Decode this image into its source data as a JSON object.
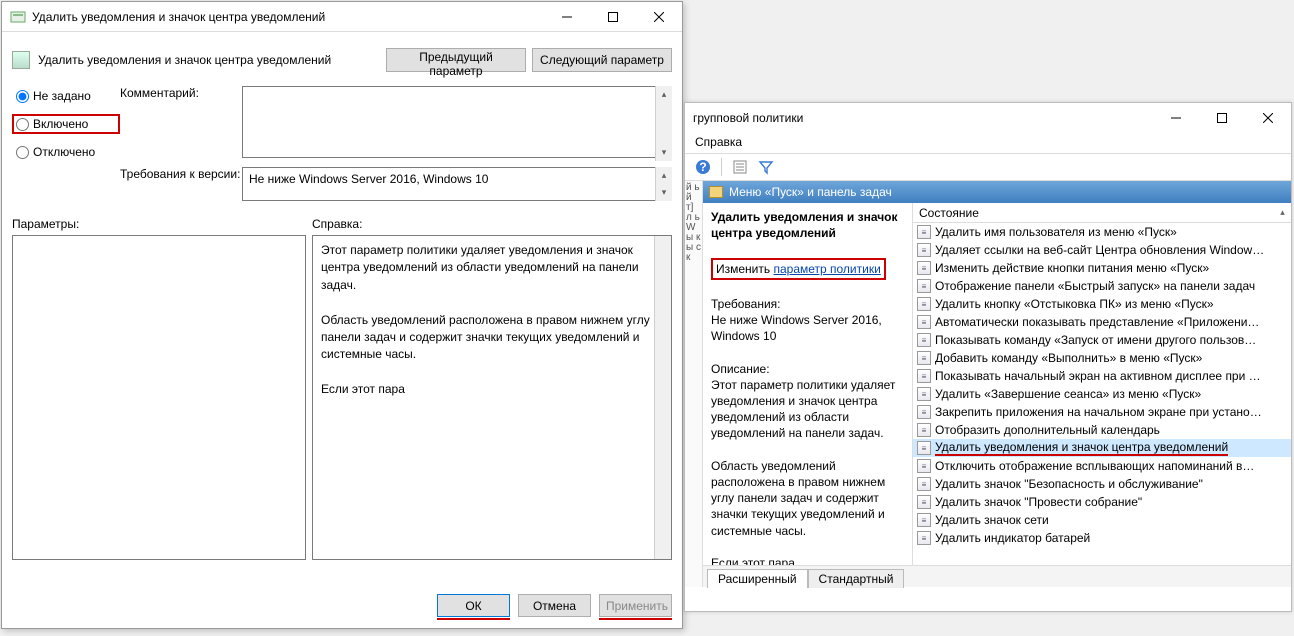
{
  "dialog": {
    "title": "Удалить уведомления и значок центра уведомлений",
    "heading": "Удалить уведомления и значок центра уведомлений",
    "nav_prev": "Предыдущий параметр",
    "nav_next": "Следующий параметр",
    "radios": {
      "not_configured": "Не задано",
      "enabled": "Включено",
      "disabled": "Отключено"
    },
    "comment_label": "Комментарий:",
    "version_label": "Требования к версии:",
    "version_value": "Не ниже Windows Server 2016, Windows 10",
    "params_label": "Параметры:",
    "help_label": "Справка:",
    "help_text": "Этот параметр политики удаляет уведомления и значок центра уведомлений из области уведомлений на панели задач.\n\nОбласть уведомлений расположена в правом нижнем углу панели задач и содержит значки текущих уведомлений и системные часы.\n\nЕсли этот пара",
    "ok": "ОК",
    "cancel": "Отмена",
    "apply": "Применить"
  },
  "mmc": {
    "title_fragment": "групповой политики",
    "menu_help": "Справка",
    "crumb": "Меню «Пуск» и панель задач",
    "left_edge": "й ь й т] л ь W ы к ы ск",
    "desc": {
      "title": "Удалить уведомления и значок центра уведомлений",
      "change_pre": "Изменить ",
      "change_link": "параметр политики",
      "req_label": "Требования:",
      "req_value": "Не ниже Windows Server 2016, Windows 10",
      "desc_label": "Описание:",
      "desc_text": "Этот параметр политики удаляет уведомления и значок центра уведомлений из области уведомлений на панели задач.\n\nОбласть уведомлений расположена в правом нижнем углу панели задач и содержит значки текущих уведомлений и системные часы.\n\nЕсли этот пара"
    },
    "list_header": "Состояние",
    "items": [
      "Удалить имя пользователя из меню «Пуск»",
      "Удаляет ссылки на веб-сайт Центра обновления Window…",
      "Изменить действие кнопки питания меню «Пуск»",
      "Отображение панели «Быстрый запуск» на панели задач",
      "Удалить кнопку «Отстыковка ПК» из меню «Пуск»",
      "Автоматически показывать представление «Приложени…",
      "Показывать команду «Запуск от имени другого пользов…",
      "Добавить команду «Выполнить» в меню «Пуск»",
      "Показывать начальный экран на активном дисплее при …",
      "Удалить «Завершение сеанса» из меню «Пуск»",
      "Закрепить приложения на начальном экране при устано…",
      "Отобразить дополнительный календарь",
      "Удалить уведомления и значок центра уведомлений",
      "Отключить отображение всплывающих напоминаний в…",
      "Удалить значок \"Безопасность и обслуживание\"",
      "Удалить значок \"Провести собрание\"",
      "Удалить значок сети",
      "Удалить индикатор батарей"
    ],
    "selected_index": 12,
    "tabs": {
      "ext": "Расширенный",
      "std": "Стандартный"
    }
  }
}
